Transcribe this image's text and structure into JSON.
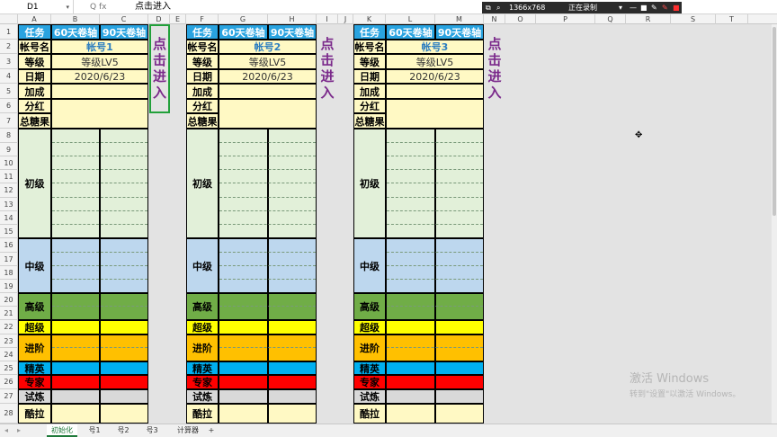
{
  "formula_bar": {
    "name_box": "D1",
    "formula_icons": "Q  fx",
    "formula_text": "点击进入"
  },
  "recorder": {
    "resolution": "1366x768",
    "status": "正在录制"
  },
  "columns": [
    "A",
    "B",
    "C",
    "D",
    "E",
    "F",
    "G",
    "H",
    "I",
    "J",
    "K",
    "L",
    "M",
    "N",
    "O",
    "P",
    "Q",
    "R",
    "S",
    "T"
  ],
  "rows": [
    "1",
    "2",
    "3",
    "4",
    "5",
    "6",
    "7",
    "8",
    "9",
    "10",
    "11",
    "12",
    "13",
    "14",
    "15",
    "16",
    "17",
    "18",
    "19",
    "20",
    "21",
    "22",
    "23",
    "24",
    "25",
    "26",
    "27",
    "28"
  ],
  "blocks": [
    {
      "headers": {
        "task": "任务",
        "col60": "60天卷轴",
        "col90": "90天卷轴"
      },
      "account_label": "帐号名",
      "account": "帐号1",
      "level_label": "等级",
      "level": "等级LV5",
      "date_label": "日期",
      "date": "2020/6/23",
      "bonus_label": "加成",
      "dividend_label": "分红",
      "candy_label": "总糖果",
      "tiers": [
        "初级",
        "中级",
        "高级",
        "超级",
        "进阶",
        "精英",
        "专家",
        "试炼",
        "酷拉"
      ],
      "enter_label": "点击进入"
    },
    {
      "headers": {
        "task": "任务",
        "col60": "60天卷轴",
        "col90": "90天卷轴"
      },
      "account_label": "帐号名",
      "account": "帐号2",
      "level_label": "等级",
      "level": "等级LV5",
      "date_label": "日期",
      "date": "2020/6/23",
      "bonus_label": "加成",
      "dividend_label": "分红",
      "candy_label": "总糖果",
      "tiers": [
        "初级",
        "中级",
        "高级",
        "超级",
        "进阶",
        "精英",
        "专家",
        "试炼",
        "酷拉"
      ],
      "enter_label": "点击进入"
    },
    {
      "headers": {
        "task": "任务",
        "col60": "60天卷轴",
        "col90": "90天卷轴"
      },
      "account_label": "帐号名",
      "account": "帐号3",
      "level_label": "等级",
      "level": "等级LV5",
      "date_label": "日期",
      "date": "2020/6/23",
      "bonus_label": "加成",
      "dividend_label": "分红",
      "candy_label": "总糖果",
      "tiers": [
        "初级",
        "中级",
        "高级",
        "超级",
        "进阶",
        "精英",
        "专家",
        "试炼",
        "酷拉"
      ],
      "enter_label": "点击进入"
    }
  ],
  "sheet_tabs": [
    "初始化",
    "号1",
    "号2",
    "号3",
    "计算器",
    "+"
  ],
  "watermark": {
    "line1": "激活 Windows",
    "line2": "转到\"设置\"以激活 Windows。"
  },
  "colors": {
    "header_blue": "#29a3e0",
    "label_yellow": "#fff9c4",
    "tier_primary": "#e2f0d9",
    "tier_middle": "#bdd7ee",
    "tier_high": "#70ad47",
    "tier_super": "#ffff00",
    "tier_advanced": "#ffc000",
    "tier_elite": "#00b0f0",
    "tier_expert": "#ff0000",
    "tier_trial": "#d9d9d9",
    "enter_text": "#7b2a8b",
    "enter_border": "#22a03a"
  }
}
